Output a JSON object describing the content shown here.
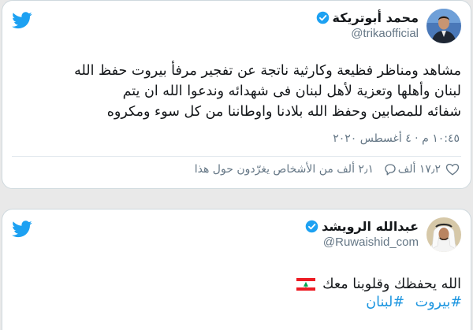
{
  "tweet1": {
    "author_name": "محمد أبوتريكة",
    "handle": "@trikaofficial",
    "text_lines": [
      "مشاهد ومناظر فظيعة وكارثية ناتجة عن تفجير مرفأ بيروت حفظ الله",
      "لبنان وأهلها وتعزية لأهل  لبنان فى شهدائه وندعوا الله ان يتم",
      "شفائه للمصابين وحفظ الله بلادنا واوطاننا من كل سوء ومكروه"
    ],
    "timestamp": "١٠:٤٥ م · ٤ أغسطس ٢٠٢٠",
    "likes": "١٧٫٢ ألف",
    "people_talking": "٢٫١ ألف من الأشخاص يغرّدون حول هذا"
  },
  "tweet2": {
    "author_name": "عبدالله الرويشد",
    "handle": "@Ruwaishid_com",
    "text": "الله يحفظك وقلوبنا معك",
    "hashtags": [
      "#بيروت",
      "#لبنان"
    ]
  },
  "colors": {
    "twitter_blue": "#1da1f2",
    "hashtag_blue": "#1b95e0",
    "text_primary": "#14171a",
    "text_secondary": "#657786"
  },
  "icons": [
    "twitter-bird-icon",
    "verified-badge-icon",
    "heart-icon",
    "reply-icon",
    "lebanon-flag-icon"
  ]
}
